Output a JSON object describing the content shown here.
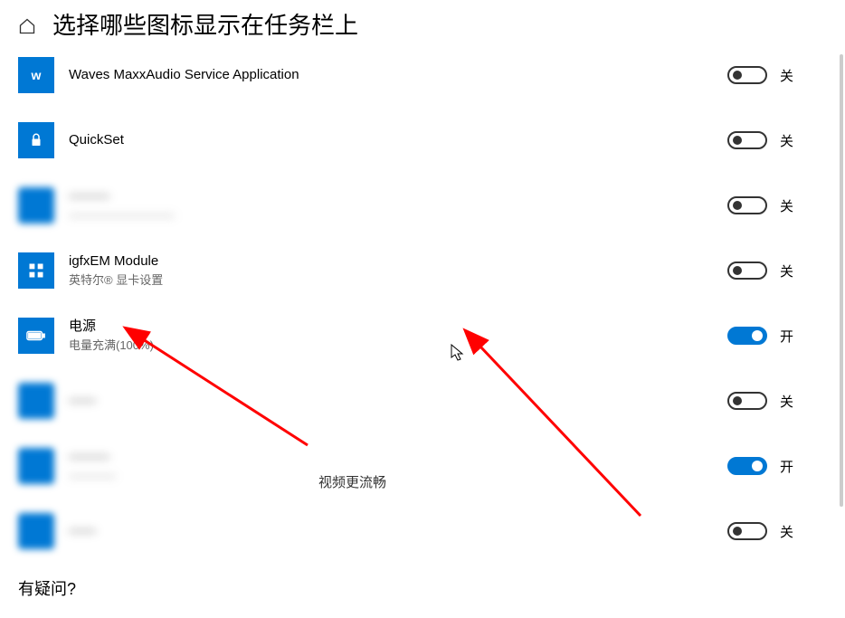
{
  "page": {
    "title": "选择哪些图标显示在任务栏上"
  },
  "toggle_labels": {
    "on": "开",
    "off": "关"
  },
  "items": [
    {
      "title": "Waves MaxxAudio Service Application",
      "subtitle": "",
      "state": "off",
      "blurred": false,
      "icon_glyph": "w"
    },
    {
      "title": "QuickSet",
      "subtitle": "",
      "state": "off",
      "blurred": false,
      "icon_glyph": "lock"
    },
    {
      "title": "———",
      "subtitle": "—————————",
      "state": "off",
      "blurred": true,
      "icon_glyph": ""
    },
    {
      "title": "igfxEM Module",
      "subtitle": "英特尔® 显卡设置",
      "state": "off",
      "blurred": false,
      "icon_glyph": "grid"
    },
    {
      "title": "电源",
      "subtitle": "电量充满(100%)",
      "state": "on",
      "blurred": false,
      "icon_glyph": "battery"
    },
    {
      "title": "——",
      "subtitle": "",
      "state": "off",
      "blurred": true,
      "icon_glyph": ""
    },
    {
      "title": "———",
      "subtitle": "————",
      "state": "on",
      "blurred": true,
      "icon_glyph": ""
    },
    {
      "title": "——",
      "subtitle": "",
      "state": "off",
      "blurred": true,
      "icon_glyph": ""
    }
  ],
  "annotation": {
    "overlay_text": "视频更流畅"
  },
  "help": {
    "title": "有疑问?"
  },
  "colors": {
    "accent": "#0078d4",
    "arrow": "#ff0000"
  }
}
